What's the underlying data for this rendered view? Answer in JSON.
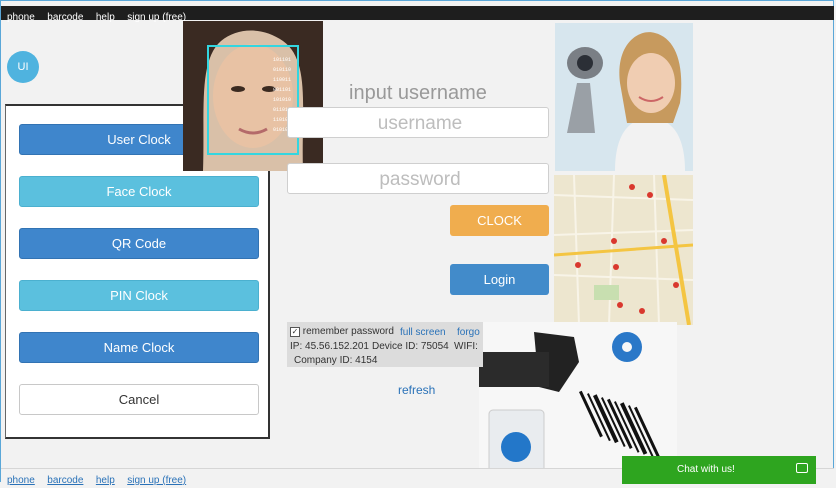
{
  "nav": {
    "phone": "phone",
    "barcode": "barcode",
    "help": "help",
    "signup": "sign up (free)"
  },
  "avatar": "UI",
  "menu": {
    "user_clock": "User Clock",
    "face_clock": "Face Clock",
    "qr_code": "QR Code",
    "pin_clock": "PIN Clock",
    "name_clock": "Name Clock",
    "cancel": "Cancel"
  },
  "login": {
    "title": "input username",
    "username_placeholder": "username",
    "password_placeholder": "password",
    "clock": "CLOCK",
    "login": "Login"
  },
  "info": {
    "remember": "remember password",
    "full_screen": "full screen",
    "forgot": "forgo",
    "ip": "IP: 45.56.152.201",
    "device": "Device ID: 75054",
    "wifi": "WIFI:",
    "company": "Company ID: 4154"
  },
  "refresh": "refresh",
  "chat": "Chat with us!"
}
